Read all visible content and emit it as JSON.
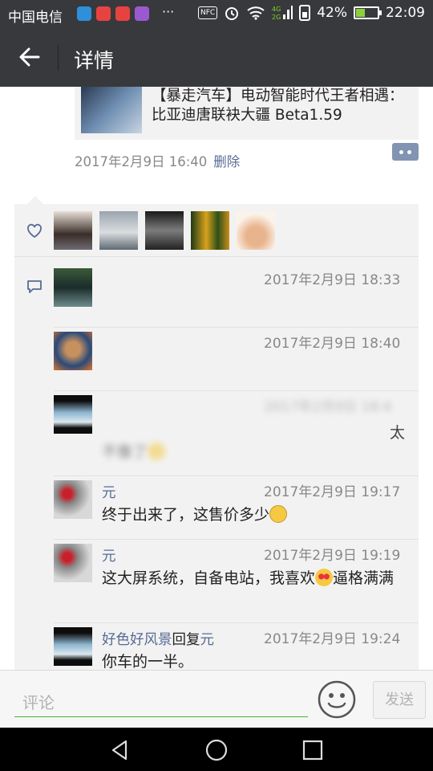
{
  "status_bar": {
    "carrier": "中国电信",
    "network_badges": [
      "NFC",
      "4G",
      "2G"
    ],
    "battery": "42%",
    "battery_level": 0.42,
    "time": "22:09",
    "overflow": "···"
  },
  "app_bar": {
    "title": "详情",
    "back_icon": "arrow-left-icon"
  },
  "post": {
    "shared_link_title": "【暴走汽车】电动智能时代王者相遇：比亚迪唐联袂大疆 Beta1.59",
    "timestamp": "2017年2月9日 16:40",
    "delete_label": "删除",
    "more_icon": "comment-more-icon"
  },
  "likes": {
    "icon": "heart-outline-icon",
    "count": 5
  },
  "comments": [
    {
      "name": "",
      "time": "2017年2月9日 18:33",
      "text": "",
      "blurred": true
    },
    {
      "name": "",
      "time": "2017年2月9日 18:40",
      "text": "",
      "blurred": true
    },
    {
      "name": "",
      "time": "2017年2月9日 18:4",
      "text": "不像了",
      "trail": "太",
      "blurred": true
    },
    {
      "name": "元",
      "time": "2017年2月9日 19:17",
      "text": "终于出来了，这售价多少",
      "emoji": "dizzy-face-emoji"
    },
    {
      "name": "元",
      "time": "2017年2月9日 19:19",
      "text": "这大屏系统，自备电站，我喜欢",
      "text_after_emoji": "逼格满满",
      "emoji": "heart-eyes-emoji"
    },
    {
      "name": "好色好风景",
      "reply_word": "回复",
      "reply_to": "元",
      "time": "2017年2月9日 19:24",
      "text": "你车的一半。"
    }
  ],
  "input_bar": {
    "placeholder": "评论",
    "send_label": "发送",
    "accent_color": "#46b336"
  },
  "colors": {
    "header_bg": "#38393d",
    "link_blue": "#576b95",
    "panel_bg": "#f2f2f2"
  }
}
